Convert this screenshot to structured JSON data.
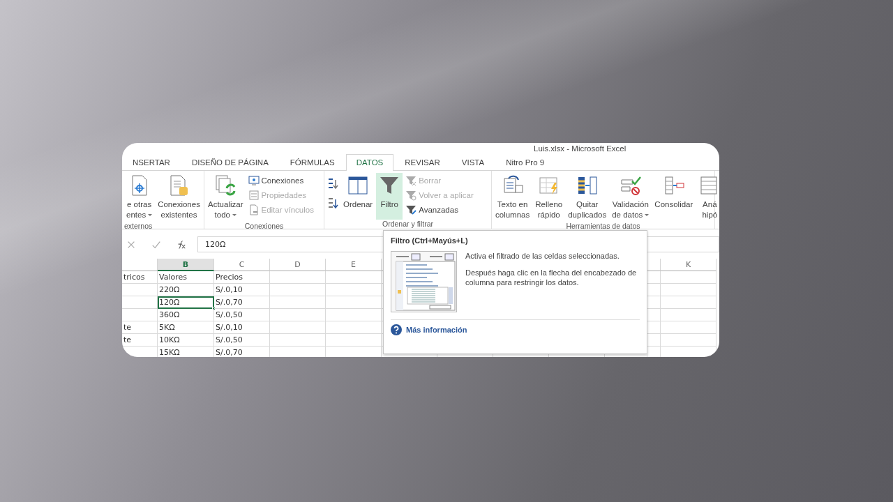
{
  "window": {
    "title": "Luis.xlsx - Microsoft Excel"
  },
  "tabs": [
    {
      "label": "NSERTAR",
      "selected": false
    },
    {
      "label": "DISEÑO DE PÁGINA",
      "selected": false
    },
    {
      "label": "FÓRMULAS",
      "selected": false
    },
    {
      "label": "DATOS",
      "selected": true
    },
    {
      "label": "REVISAR",
      "selected": false
    },
    {
      "label": "VISTA",
      "selected": false
    },
    {
      "label": "Nitro Pro 9",
      "selected": false
    }
  ],
  "ribbon": {
    "groups": [
      {
        "label": "externos",
        "items": [
          {
            "kind": "large",
            "lines": [
              "e otras",
              "entes"
            ],
            "dropdown": true,
            "selected": false
          },
          {
            "kind": "large",
            "lines": [
              "Conexiones",
              "existentes"
            ],
            "dropdown": false,
            "selected": false
          }
        ]
      },
      {
        "label": "Conexiones",
        "items": [
          {
            "kind": "large",
            "lines": [
              "Actualizar",
              "todo"
            ],
            "dropdown": true,
            "selected": false
          },
          {
            "kind": "stack",
            "entries": [
              {
                "label": "Conexiones",
                "disabled": false
              },
              {
                "label": "Propiedades",
                "disabled": true
              },
              {
                "label": "Editar vínculos",
                "disabled": true
              }
            ]
          }
        ]
      },
      {
        "label": "Ordenar y filtrar",
        "items": [
          {
            "kind": "sort"
          },
          {
            "kind": "large",
            "lines": [
              "Ordenar"
            ],
            "dropdown": false,
            "selected": false
          },
          {
            "kind": "large",
            "lines": [
              "Filtro"
            ],
            "dropdown": false,
            "selected": true
          },
          {
            "kind": "stack",
            "entries": [
              {
                "label": "Borrar",
                "disabled": true
              },
              {
                "label": "Volver a aplicar",
                "disabled": true
              },
              {
                "label": "Avanzadas",
                "disabled": false
              }
            ]
          }
        ]
      },
      {
        "label": "Herramientas de datos",
        "items": [
          {
            "kind": "large",
            "lines": [
              "Texto en",
              "columnas"
            ],
            "dropdown": false,
            "selected": false
          },
          {
            "kind": "large",
            "lines": [
              "Relleno",
              "rápido"
            ],
            "dropdown": false,
            "selected": false
          },
          {
            "kind": "large",
            "lines": [
              "Quitar",
              "duplicados"
            ],
            "dropdown": false,
            "selected": false
          },
          {
            "kind": "large",
            "lines": [
              "Validación",
              "de datos"
            ],
            "dropdown": true,
            "selected": false
          },
          {
            "kind": "large",
            "lines": [
              "Consolidar"
            ],
            "dropdown": false,
            "selected": false
          },
          {
            "kind": "large",
            "lines": [
              "Aná",
              "hipó"
            ],
            "dropdown": false,
            "selected": false
          }
        ]
      }
    ]
  },
  "formula_bar": {
    "value": "120Ω"
  },
  "columns": [
    {
      "label": "B",
      "selected": true
    },
    {
      "label": "C",
      "selected": false
    },
    {
      "label": "D",
      "selected": false
    },
    {
      "label": "E",
      "selected": false
    },
    {
      "label": "K",
      "selected": false
    }
  ],
  "rows": [
    {
      "cells": [
        {
          "text": "tricos",
          "selected": false
        },
        {
          "text": "Valores",
          "selected": false
        },
        {
          "text": "Precios",
          "selected": false
        }
      ]
    },
    {
      "cells": [
        null,
        {
          "text": "220Ω",
          "selected": false
        },
        {
          "text": "S/.0,10",
          "selected": false
        }
      ]
    },
    {
      "cells": [
        null,
        {
          "text": "120Ω",
          "selected": true
        },
        {
          "text": "S/.0,70",
          "selected": false
        }
      ]
    },
    {
      "cells": [
        null,
        {
          "text": "360Ω",
          "selected": false
        },
        {
          "text": "S/.0,50",
          "selected": false
        }
      ]
    },
    {
      "cells": [
        {
          "text": "te",
          "selected": false
        },
        {
          "text": "5KΩ",
          "selected": false
        },
        {
          "text": "S/.0,10",
          "selected": false
        }
      ]
    },
    {
      "cells": [
        {
          "text": "te",
          "selected": false
        },
        {
          "text": "10KΩ",
          "selected": false
        },
        {
          "text": "S/.0,50",
          "selected": false
        }
      ]
    },
    {
      "cells": [
        null,
        {
          "text": "15KΩ",
          "selected": false
        },
        {
          "text": "S/.0,70",
          "selected": false
        }
      ]
    }
  ],
  "tooltip": {
    "title": "Filtro (Ctrl+Mayús+L)",
    "paragraphs": [
      "Activa el filtrado de las celdas seleccionadas.",
      "Después haga clic en la flecha del encabezado de columna para restringir los datos."
    ],
    "link": "Más información"
  }
}
